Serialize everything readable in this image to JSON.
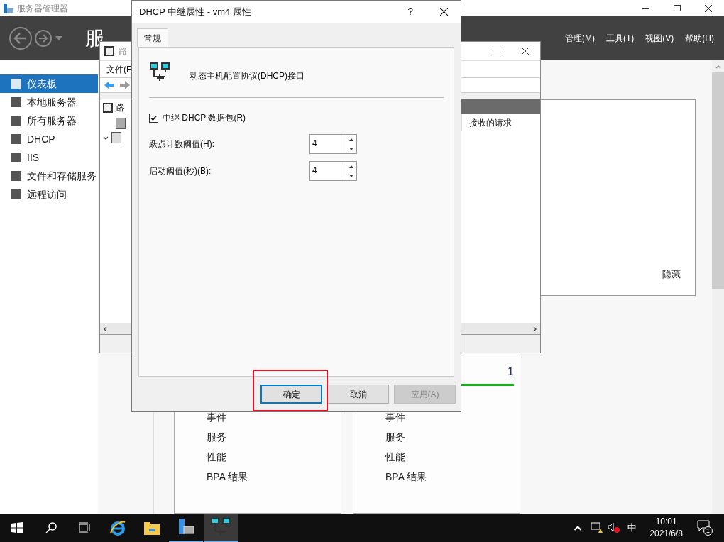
{
  "server_manager": {
    "title": "服务器管理器",
    "header_title": "服",
    "menus": [
      "管理(M)",
      "工具(T)",
      "视图(V)",
      "帮助(H)"
    ],
    "sidebar": [
      {
        "label": "仪表板",
        "selected": true
      },
      {
        "label": "本地服务器",
        "selected": false
      },
      {
        "label": "所有服务器",
        "selected": false
      },
      {
        "label": "DHCP",
        "selected": false
      },
      {
        "label": "IIS",
        "selected": false
      },
      {
        "label": "文件和存储服务",
        "selected": false
      },
      {
        "label": "远程访问",
        "selected": false
      }
    ],
    "hide_link": "隐藏",
    "tiles": [
      {
        "items": [
          "事件",
          "服务",
          "性能",
          "BPA 结果"
        ]
      },
      {
        "count": "1",
        "items": [
          "事件",
          "服务",
          "性能",
          "BPA 结果"
        ]
      }
    ]
  },
  "routing_window": {
    "title": "路",
    "menu": "文件(F",
    "tree_root": "路",
    "column": "接收的请求"
  },
  "dialog": {
    "title": "DHCP 中继属性 - vm4 属性",
    "help": "?",
    "tabs": [
      {
        "label": "常规",
        "selected": true
      }
    ],
    "interface_label": "动态主机配置协议(DHCP)接口",
    "relay": {
      "label": "中继 DHCP 数据包(R)",
      "checked": true
    },
    "fields": [
      {
        "label": "跃点计数阈值(H):",
        "value": "4"
      },
      {
        "label": "启动阈值(秒)(B):",
        "value": "4"
      }
    ],
    "buttons": [
      {
        "label": "确定",
        "kind": "default",
        "disabled": false
      },
      {
        "label": "取消",
        "kind": "normal",
        "disabled": false
      },
      {
        "label": "应用(A)",
        "kind": "normal",
        "disabled": true
      }
    ]
  },
  "taskbar": {
    "ime": "中",
    "time": "10:01",
    "date": "2021/6/8",
    "notifications": "1"
  }
}
